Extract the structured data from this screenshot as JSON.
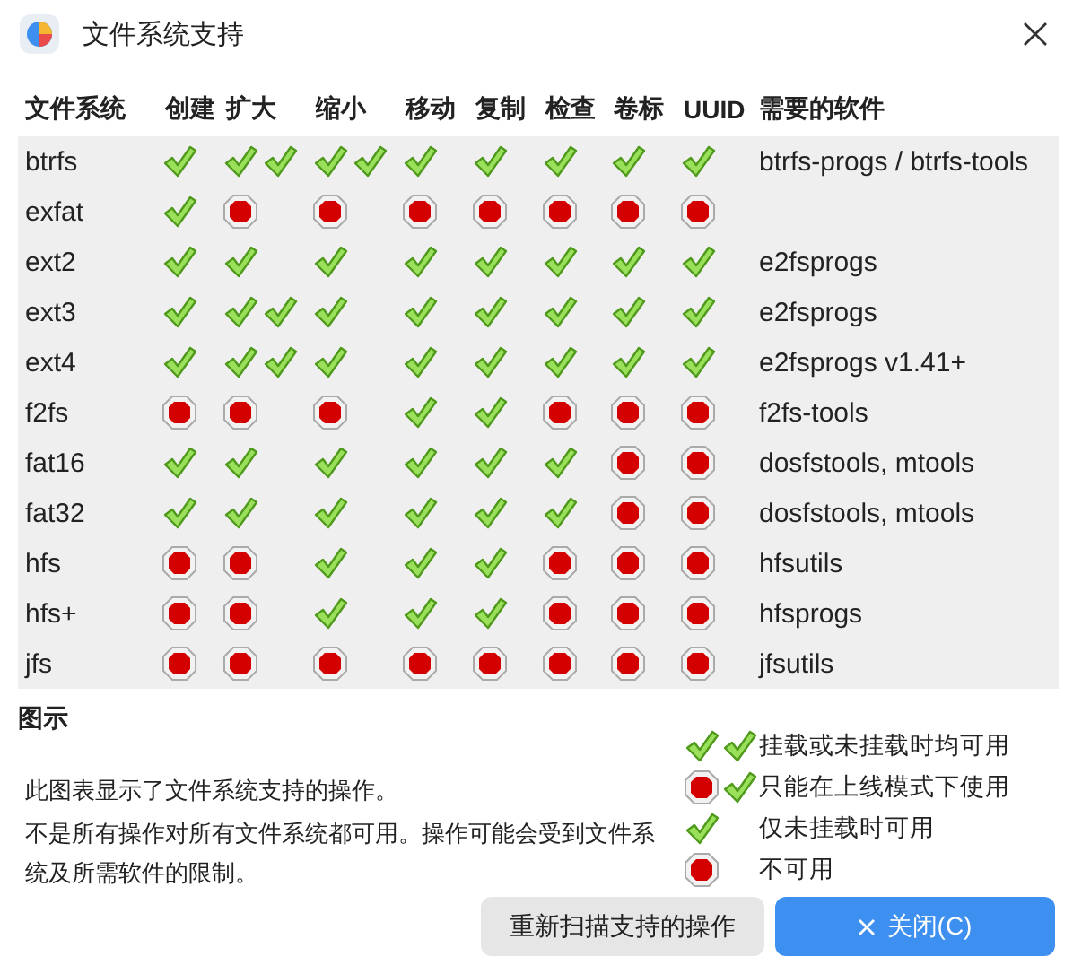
{
  "window": {
    "title": "文件系统支持"
  },
  "table": {
    "columns": [
      "文件系统",
      "创建",
      "扩大",
      "缩小",
      "移动",
      "复制",
      "检查",
      "卷标",
      "UUID",
      "需要的软件"
    ],
    "rows": [
      {
        "filesystem": "btrfs",
        "cells": [
          {
            "kind": "offline"
          },
          {
            "kind": "both"
          },
          {
            "kind": "both"
          },
          {
            "kind": "offline"
          },
          {
            "kind": "offline"
          },
          {
            "kind": "offline"
          },
          {
            "kind": "offline"
          },
          {
            "kind": "offline"
          }
        ],
        "software": "btrfs-progs / btrfs-tools"
      },
      {
        "filesystem": "exfat",
        "cells": [
          {
            "kind": "offline"
          },
          {
            "kind": "none"
          },
          {
            "kind": "none"
          },
          {
            "kind": "none"
          },
          {
            "kind": "none"
          },
          {
            "kind": "none"
          },
          {
            "kind": "none"
          },
          {
            "kind": "none"
          }
        ]
      },
      {
        "filesystem": "ext2",
        "cells": [
          {
            "kind": "offline"
          },
          {
            "kind": "offline"
          },
          {
            "kind": "offline"
          },
          {
            "kind": "offline"
          },
          {
            "kind": "offline"
          },
          {
            "kind": "offline"
          },
          {
            "kind": "offline"
          },
          {
            "kind": "offline"
          }
        ],
        "software": "e2fsprogs"
      },
      {
        "filesystem": "ext3",
        "cells": [
          {
            "kind": "offline"
          },
          {
            "kind": "both"
          },
          {
            "kind": "offline"
          },
          {
            "kind": "offline"
          },
          {
            "kind": "offline"
          },
          {
            "kind": "offline"
          },
          {
            "kind": "offline"
          },
          {
            "kind": "offline"
          }
        ],
        "software": "e2fsprogs"
      },
      {
        "filesystem": "ext4",
        "cells": [
          {
            "kind": "offline"
          },
          {
            "kind": "both"
          },
          {
            "kind": "offline"
          },
          {
            "kind": "offline"
          },
          {
            "kind": "offline"
          },
          {
            "kind": "offline"
          },
          {
            "kind": "offline"
          },
          {
            "kind": "offline"
          }
        ],
        "software": "e2fsprogs v1.41+"
      },
      {
        "filesystem": "f2fs",
        "cells": [
          {
            "kind": "none"
          },
          {
            "kind": "none"
          },
          {
            "kind": "none"
          },
          {
            "kind": "offline"
          },
          {
            "kind": "offline"
          },
          {
            "kind": "none"
          },
          {
            "kind": "none"
          },
          {
            "kind": "none"
          }
        ],
        "software": "f2fs-tools"
      },
      {
        "filesystem": "fat16",
        "cells": [
          {
            "kind": "offline"
          },
          {
            "kind": "offline"
          },
          {
            "kind": "offline"
          },
          {
            "kind": "offline"
          },
          {
            "kind": "offline"
          },
          {
            "kind": "offline"
          },
          {
            "kind": "none"
          },
          {
            "kind": "none"
          }
        ],
        "software": "dosfstools, mtools"
      },
      {
        "filesystem": "fat32",
        "cells": [
          {
            "kind": "offline"
          },
          {
            "kind": "offline"
          },
          {
            "kind": "offline"
          },
          {
            "kind": "offline"
          },
          {
            "kind": "offline"
          },
          {
            "kind": "offline"
          },
          {
            "kind": "none"
          },
          {
            "kind": "none"
          }
        ],
        "software": "dosfstools, mtools"
      },
      {
        "filesystem": "hfs",
        "cells": [
          {
            "kind": "none"
          },
          {
            "kind": "none"
          },
          {
            "kind": "offline"
          },
          {
            "kind": "offline"
          },
          {
            "kind": "offline"
          },
          {
            "kind": "none"
          },
          {
            "kind": "none"
          },
          {
            "kind": "none"
          }
        ],
        "software": "hfsutils"
      },
      {
        "filesystem": "hfs+",
        "cells": [
          {
            "kind": "none"
          },
          {
            "kind": "none"
          },
          {
            "kind": "offline"
          },
          {
            "kind": "offline"
          },
          {
            "kind": "offline"
          },
          {
            "kind": "none"
          },
          {
            "kind": "none"
          },
          {
            "kind": "none"
          }
        ],
        "software": "hfsprogs"
      },
      {
        "filesystem": "jfs",
        "cells": [
          {
            "kind": "none"
          },
          {
            "kind": "none"
          },
          {
            "kind": "none"
          },
          {
            "kind": "none"
          },
          {
            "kind": "none"
          },
          {
            "kind": "none"
          },
          {
            "kind": "none"
          },
          {
            "kind": "none"
          }
        ],
        "software": "jfsutils"
      }
    ]
  },
  "legend": {
    "title": "图示",
    "description": [
      "此图表显示了文件系统支持的操作。",
      "不是所有操作对所有文件系统都可用。操作可能会受到文件系统及所需软件的限制。"
    ],
    "items": [
      {
        "kind": "both",
        "label": "挂载或未挂载时均可用"
      },
      {
        "kind": "online",
        "label": "只能在上线模式下使用"
      },
      {
        "kind": "offline",
        "label": "仅未挂载时可用"
      },
      {
        "kind": "none",
        "label": "不可用"
      }
    ]
  },
  "buttons": [
    {
      "kind": "plain",
      "label": "重新扫描支持的操作"
    },
    {
      "kind": "primary",
      "label": "关闭(C)"
    }
  ]
}
